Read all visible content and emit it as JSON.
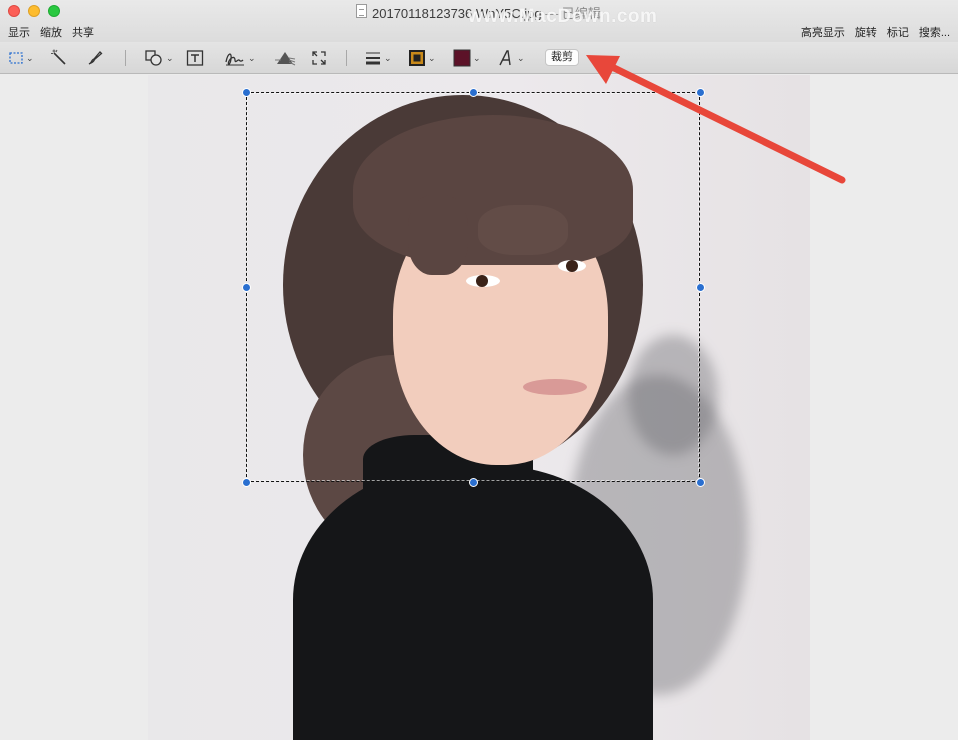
{
  "window": {
    "title": "20170118123736 WnY5C.jpg",
    "title_suffix": " — 已编辑",
    "watermark": "www.MacDown.com"
  },
  "menu_left": [
    "显示",
    "缩放",
    "共享"
  ],
  "menu_right": [
    "高亮显示",
    "旋转",
    "标记",
    "搜索..."
  ],
  "toolbar": {
    "tools": [
      {
        "name": "rectangular-selection",
        "icon": "dashed-rect-icon"
      },
      {
        "name": "instant-alpha",
        "icon": "magic-wand-icon"
      },
      {
        "name": "sketch",
        "icon": "pen-icon"
      },
      {
        "name": "shapes",
        "icon": "shapes-icon"
      },
      {
        "name": "text",
        "icon": "text-box-icon"
      },
      {
        "name": "sign",
        "icon": "signature-icon"
      },
      {
        "name": "adjust-color",
        "icon": "prism-icon"
      },
      {
        "name": "adjust-size",
        "icon": "resize-icon"
      },
      {
        "name": "shape-style",
        "icon": "lines-icon"
      },
      {
        "name": "border-color",
        "icon": "border-color-icon"
      },
      {
        "name": "fill-color",
        "icon": "fill-color-icon"
      },
      {
        "name": "text-style",
        "icon": "font-icon"
      }
    ],
    "crop_label": "裁剪",
    "border_color": "#c8891a",
    "fill_color": "#5c1228"
  },
  "colors": {
    "selection_handle": "#2a6fd0",
    "arrow": "#e8473a"
  }
}
